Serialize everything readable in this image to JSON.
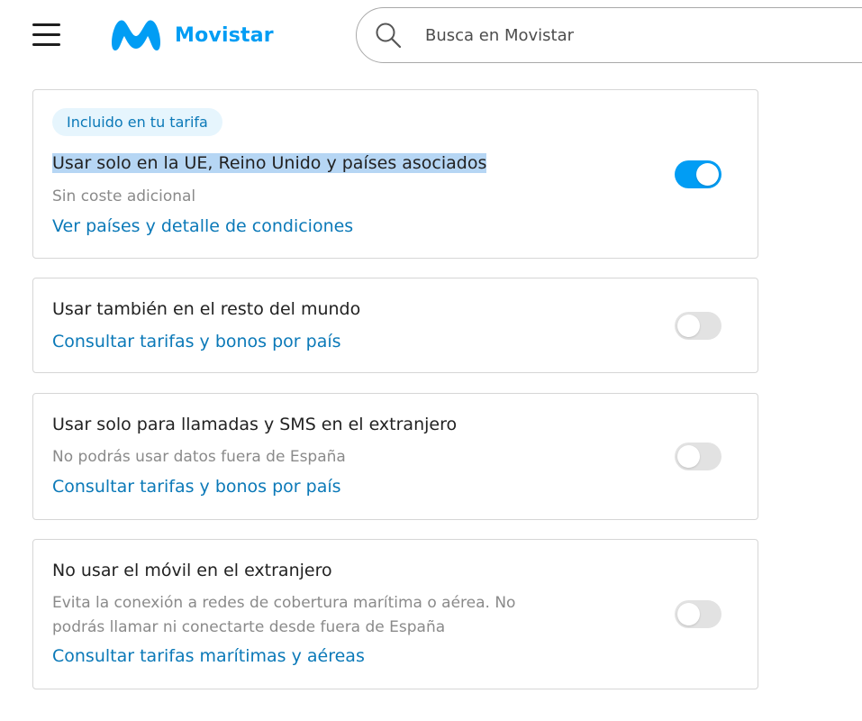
{
  "header": {
    "menu_icon": "hamburger-menu-icon",
    "brand": "Movistar",
    "brand_color": "#019df4",
    "search": {
      "placeholder": "Busca en Movistar",
      "icon": "search-icon"
    }
  },
  "options": [
    {
      "badge": "Incluido en tu tarifa",
      "title": "Usar solo en la UE, Reino Unido y países asociados",
      "subtitle": "Sin coste adicional",
      "link": "Ver países y detalle de condiciones",
      "enabled": true
    },
    {
      "title": "Usar también en el resto del mundo",
      "link": "Consultar tarifas y bonos por país",
      "enabled": false
    },
    {
      "title": "Usar solo para llamadas y SMS en el extranjero",
      "subtitle": "No podrás usar datos fuera de España",
      "link": "Consultar tarifas y bonos por país",
      "enabled": false
    },
    {
      "title": "No usar el móvil en el extranjero",
      "subtitle_line1": "Evita la conexión a redes de cobertura marítima o aérea. No",
      "subtitle_line2": "podrás llamar ni conectarte desde fuera de España",
      "link": "Consultar tarifas marítimas y aéreas",
      "enabled": false
    }
  ],
  "colors": {
    "accent": "#019df4",
    "link": "#0b79b8",
    "toggle_off": "#e2e2e2",
    "selection": "#b6d6f4"
  }
}
